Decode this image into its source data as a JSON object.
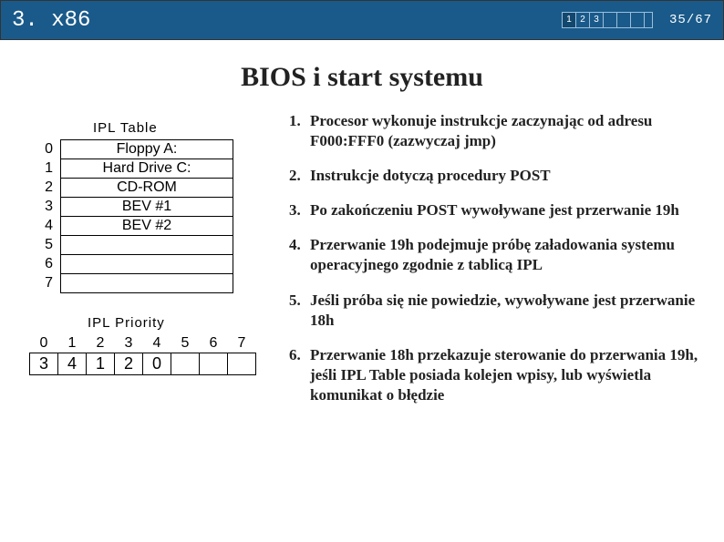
{
  "header": {
    "title": "3. x86",
    "progress": {
      "cells": [
        "1",
        "2",
        "3"
      ],
      "total_cells": 7
    },
    "page_counter": "35/67"
  },
  "slide_title": "BIOS i start systemu",
  "ipl_table": {
    "label": "IPL Table",
    "rows": [
      {
        "idx": "0",
        "value": "Floppy A:"
      },
      {
        "idx": "1",
        "value": "Hard Drive C:"
      },
      {
        "idx": "2",
        "value": "CD-ROM"
      },
      {
        "idx": "3",
        "value": "BEV #1"
      },
      {
        "idx": "4",
        "value": "BEV #2"
      },
      {
        "idx": "5",
        "value": ""
      },
      {
        "idx": "6",
        "value": ""
      },
      {
        "idx": "7",
        "value": ""
      }
    ]
  },
  "ipl_priority": {
    "label": "IPL Priority",
    "indices": [
      "0",
      "1",
      "2",
      "3",
      "4",
      "5",
      "6",
      "7"
    ],
    "values": [
      "3",
      "4",
      "1",
      "2",
      "0",
      "",
      "",
      ""
    ]
  },
  "steps": [
    "Procesor wykonuje instrukcje zaczynając od adresu F000:FFF0 (zazwyczaj jmp)",
    "Instrukcje dotyczą procedury POST",
    "Po zakończeniu POST wywoływane jest przerwanie 19h",
    "Przerwanie 19h podejmuje próbę załadowania systemu operacyjnego zgodnie z tablicą IPL",
    "Jeśli próba się nie powiedzie, wywoływane jest przerwanie 18h",
    "Przerwanie 18h przekazuje sterowanie do przerwania 19h, jeśli IPL Table posiada kolejen wpisy, lub wyświetla komunikat o błędzie"
  ]
}
